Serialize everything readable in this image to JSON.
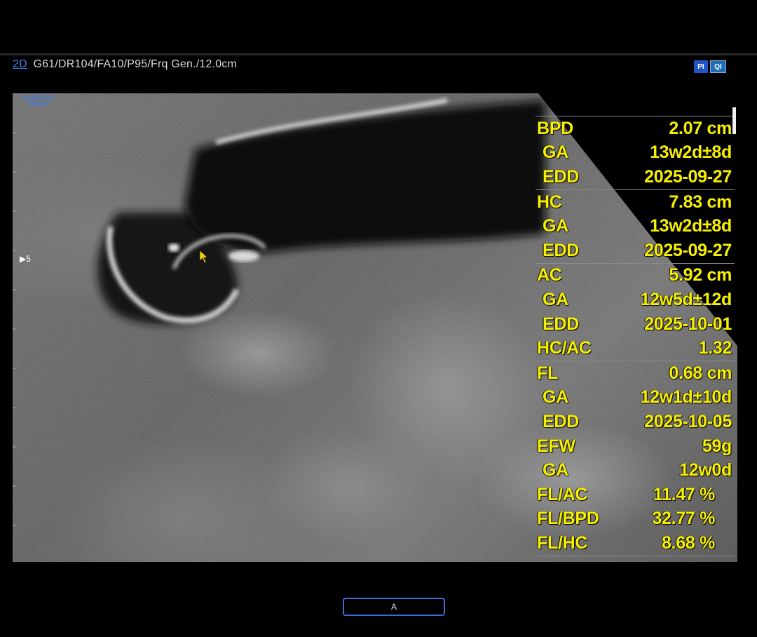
{
  "header": {
    "mode": "2D",
    "params": "G61/DR104/FA10/P95/Frq Gen./12.0cm",
    "badges": {
      "pi": "PI",
      "qi": "QI"
    }
  },
  "image": {
    "watermark_line1": "SAMSUNG",
    "watermark_line2": "WS80A",
    "depth_marker": "5"
  },
  "measurements": [
    {
      "rows": [
        {
          "label": "BPD",
          "value": "2.07 cm"
        },
        {
          "label": "GA",
          "value": "13w2d±8d",
          "sub": true
        },
        {
          "label": "EDD",
          "value": "2025-09-27",
          "sub": true
        }
      ]
    },
    {
      "rows": [
        {
          "label": "HC",
          "value": "7.83 cm"
        },
        {
          "label": "GA",
          "value": "13w2d±8d",
          "sub": true
        },
        {
          "label": "EDD",
          "value": "2025-09-27",
          "sub": true
        }
      ]
    },
    {
      "rows": [
        {
          "label": "AC",
          "value": "5.92 cm"
        },
        {
          "label": "GA",
          "value": "12w5d±12d",
          "sub": true
        },
        {
          "label": "EDD",
          "value": "2025-10-01",
          "sub": true
        },
        {
          "label": "HC/AC",
          "value": "1.32"
        }
      ]
    },
    {
      "rows": [
        {
          "label": "FL",
          "value": "0.68 cm"
        },
        {
          "label": "GA",
          "value": "12w1d±10d",
          "sub": true
        },
        {
          "label": "EDD",
          "value": "2025-10-05",
          "sub": true
        },
        {
          "label": "EFW",
          "value": "59g"
        },
        {
          "label": "GA",
          "value": "12w0d",
          "sub": true
        },
        {
          "label": "FL/AC",
          "value": "11.47 %"
        },
        {
          "label": "FL/BPD",
          "value": "32.77 %"
        },
        {
          "label": "FL/HC",
          "value": "8.68 %"
        }
      ]
    }
  ],
  "footer": {
    "button_label": "A"
  },
  "colors": {
    "measurement_text": "#f7f000",
    "accent": "#3a6fd8"
  }
}
